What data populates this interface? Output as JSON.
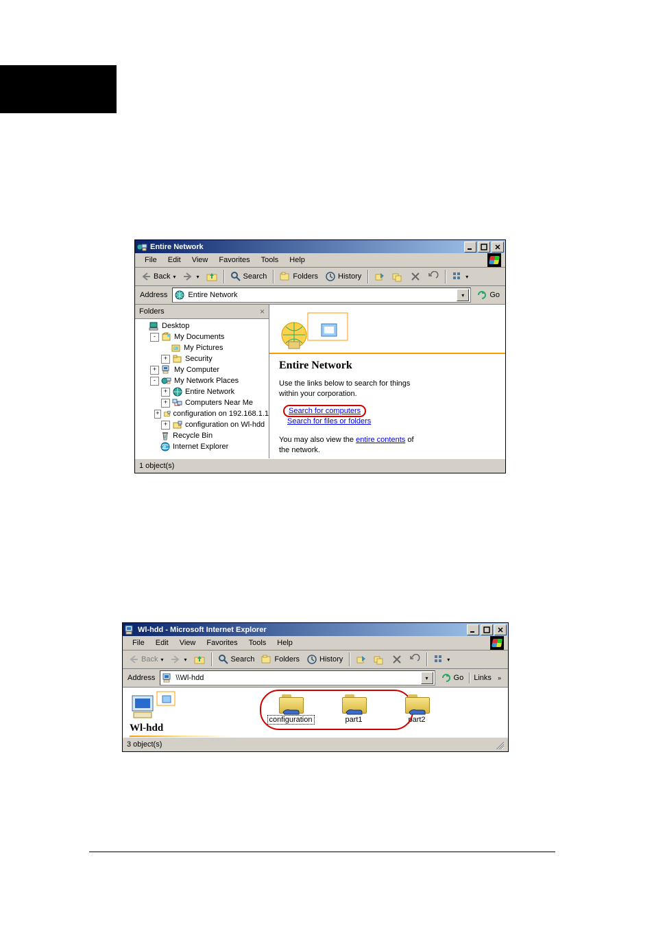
{
  "window1": {
    "title": "Entire Network",
    "menus": [
      "File",
      "Edit",
      "View",
      "Favorites",
      "Tools",
      "Help"
    ],
    "toolbar": {
      "back": "Back",
      "search": "Search",
      "folders": "Folders",
      "history": "History"
    },
    "address_label": "Address",
    "address_value": "Entire Network",
    "go_label": "Go",
    "folders_pane_title": "Folders",
    "tree": [
      {
        "indent": 0,
        "exp": "",
        "icon": "desktop",
        "label": "Desktop"
      },
      {
        "indent": 1,
        "exp": "-",
        "icon": "mydocs",
        "label": "My Documents"
      },
      {
        "indent": 2,
        "exp": "",
        "icon": "pics",
        "label": "My Pictures"
      },
      {
        "indent": 2,
        "exp": "+",
        "icon": "folder",
        "label": "Security"
      },
      {
        "indent": 1,
        "exp": "+",
        "icon": "computer",
        "label": "My Computer"
      },
      {
        "indent": 1,
        "exp": "-",
        "icon": "netplaces",
        "label": "My Network Places"
      },
      {
        "indent": 2,
        "exp": "+",
        "icon": "globe",
        "label": "Entire Network"
      },
      {
        "indent": 2,
        "exp": "+",
        "icon": "nearme",
        "label": "Computers Near Me"
      },
      {
        "indent": 2,
        "exp": "+",
        "icon": "netfolder",
        "label": "configuration on 192.168.1.1"
      },
      {
        "indent": 2,
        "exp": "+",
        "icon": "netfolder",
        "label": "configuration on Wl-hdd"
      },
      {
        "indent": 1,
        "exp": "",
        "icon": "recycle",
        "label": "Recycle Bin"
      },
      {
        "indent": 1,
        "exp": "",
        "icon": "ie",
        "label": "Internet Explorer"
      }
    ],
    "content": {
      "heading": "Entire Network",
      "intro": "Use the links below to search for things within your corporation.",
      "link_computers": "Search for computers",
      "link_files": "Search for files or folders",
      "outro_pre": "You may also view the ",
      "outro_link": "entire contents",
      "outro_post": " of the network."
    },
    "status": "1 object(s)"
  },
  "window2": {
    "title": "Wl-hdd - Microsoft Internet Explorer",
    "menus": [
      "File",
      "Edit",
      "View",
      "Favorites",
      "Tools",
      "Help"
    ],
    "toolbar": {
      "back": "Back",
      "search": "Search",
      "folders": "Folders",
      "history": "History"
    },
    "address_label": "Address",
    "address_value": "\\\\Wl-hdd",
    "go_label": "Go",
    "links_label": "Links",
    "heading": "Wl-hdd",
    "shares": [
      "configuration",
      "part1",
      "part2"
    ],
    "status": "3 object(s)"
  }
}
